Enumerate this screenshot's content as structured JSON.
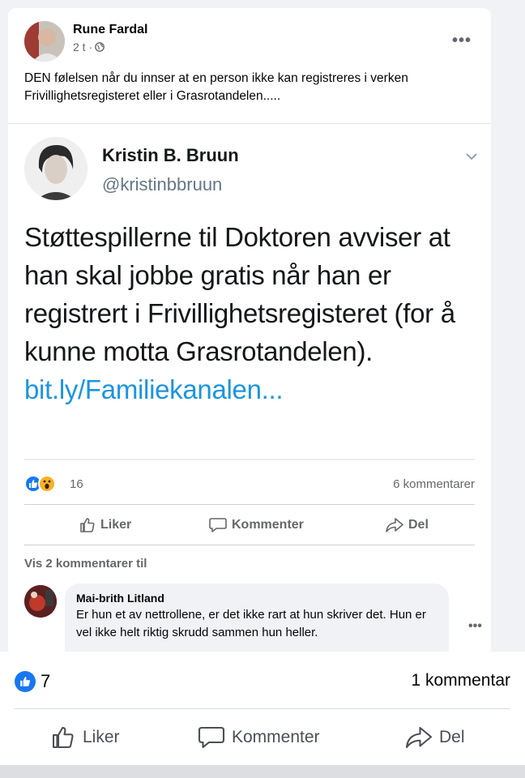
{
  "post": {
    "author": "Rune Fardal",
    "time": "2 t ·",
    "text": "DEN følelsen når du innser at en person ikke kan registreres i verken Frivillighetsregisteret eller i Grasrotandelen....."
  },
  "embed": {
    "name": "Kristin B. Bruun",
    "handle": "@kristinbbruun",
    "text": "Støttespillerne til Doktoren avviser at han skal jobbe gratis når han er registrert i Frivillighetsregisteret (for å kunne motta Grasrotandelen).",
    "link": "bit.ly/Familiekanalen..."
  },
  "stats": {
    "reaction_count": "16",
    "comments": "6 kommentarer"
  },
  "actions": {
    "like": "Liker",
    "comment": "Kommenter",
    "share": "Del"
  },
  "comments_section": {
    "more": "Vis 2 kommentarer til",
    "first": {
      "author": "Mai-brith Litland",
      "text": "Er hun et av nettrollene, er det ikke rart at hun skriver det. Hun er vel ikke helt riktig skrudd sammen hun heller."
    }
  },
  "bottom": {
    "like_count": "7",
    "comments": "1 kommentar",
    "like": "Liker",
    "comment": "Kommenter",
    "share": "Del"
  },
  "colors": {
    "accent": "#1877f2",
    "link": "#1b95e0",
    "muted": "#65676b"
  }
}
